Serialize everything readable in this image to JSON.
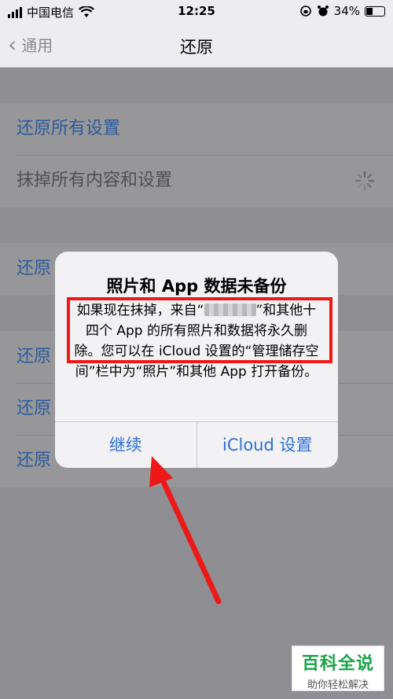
{
  "status_bar": {
    "carrier": "中国电信",
    "time": "12:25",
    "battery": "34%"
  },
  "nav": {
    "back_label": "通用",
    "title": "还原"
  },
  "settings_list": {
    "items": [
      {
        "label": "还原所有设置"
      },
      {
        "label": "抹掉所有内容和设置"
      },
      {
        "label": "还原"
      },
      {
        "label": "还原"
      },
      {
        "label": "还原"
      },
      {
        "label": "还原"
      }
    ]
  },
  "alert": {
    "title": "照片和 App 数据未备份",
    "message_part1": "如果现在抹掉，来自“",
    "message_part2": "”和其他十四个 App 的所有照片和数据将永久删除。您可以在 iCloud 设置的“管理储存空间”栏中为“照片”和其他 App 打开备份。",
    "continue_label": "继续",
    "icloud_label": "iCloud 设置"
  },
  "annotation": {
    "box_color": "#ee1818",
    "arrow_color": "#ee1818"
  },
  "watermark": {
    "line1": "百科全说",
    "line2": "助你轻松解决"
  }
}
